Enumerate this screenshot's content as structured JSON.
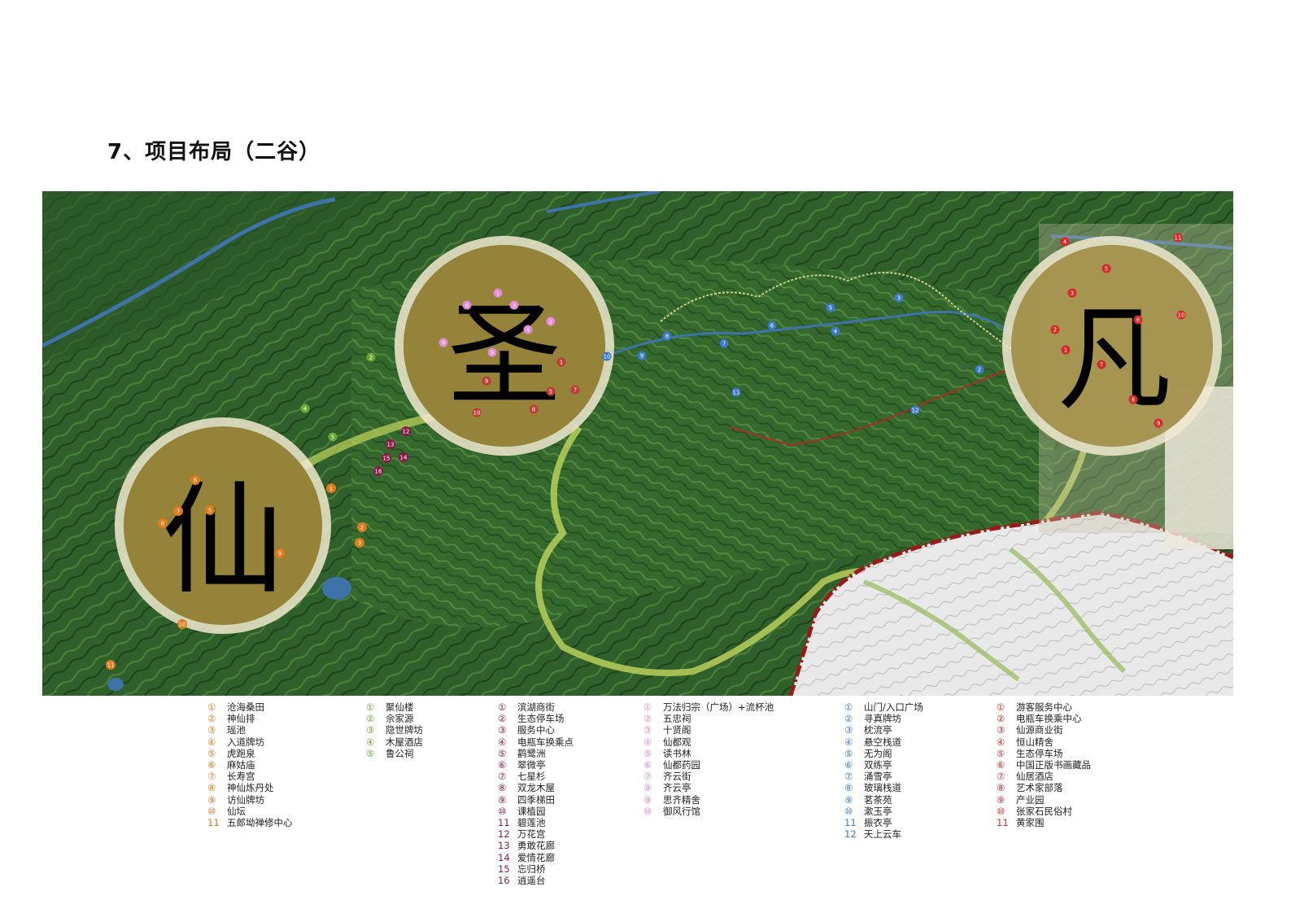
{
  "page": {
    "title": "7、项目布局（二谷）"
  },
  "zones": {
    "xian": "仙",
    "sheng": "圣",
    "fan": "凡"
  },
  "legend": {
    "col1": {
      "color": "#e07b1c",
      "items": [
        {
          "n": "①",
          "t": "沧海桑田"
        },
        {
          "n": "②",
          "t": "神仙排"
        },
        {
          "n": "③",
          "t": "瑶池"
        },
        {
          "n": "④",
          "t": "入道牌坊"
        },
        {
          "n": "⑤",
          "t": "虎跑泉"
        },
        {
          "n": "⑥",
          "t": "麻姑庙"
        },
        {
          "n": "⑦",
          "t": "长寿宫"
        },
        {
          "n": "⑧",
          "t": "神仙炼丹处"
        },
        {
          "n": "⑨",
          "t": "访仙牌坊"
        },
        {
          "n": "⑩",
          "t": "仙坛"
        },
        {
          "n": "11",
          "t": "五郎坳禅修中心"
        }
      ]
    },
    "col2": {
      "color": "#6aa632",
      "items": [
        {
          "n": "①",
          "t": "聚仙楼"
        },
        {
          "n": "②",
          "t": "佘家源"
        },
        {
          "n": "③",
          "t": "隐世牌坊"
        },
        {
          "n": "④",
          "t": "木屋酒店"
        },
        {
          "n": "⑤",
          "t": "鲁公祠"
        }
      ]
    },
    "col3": {
      "color": "#8a1a4a",
      "items": [
        {
          "n": "①",
          "t": "滨湖商街"
        },
        {
          "n": "②",
          "t": "生态停车场"
        },
        {
          "n": "③",
          "t": "服务中心"
        },
        {
          "n": "④",
          "t": "电瓶车换乘点"
        },
        {
          "n": "⑤",
          "t": "鹳鹭洲"
        },
        {
          "n": "⑥",
          "t": "翠微亭"
        },
        {
          "n": "⑦",
          "t": "七星杉"
        },
        {
          "n": "⑧",
          "t": "双龙木屋"
        },
        {
          "n": "⑨",
          "t": "四季梯田"
        },
        {
          "n": "⑩",
          "t": "课植园"
        },
        {
          "n": "11",
          "t": "碧莲池"
        },
        {
          "n": "12",
          "t": "万花宫"
        },
        {
          "n": "13",
          "t": "勇敢花廊"
        },
        {
          "n": "14",
          "t": "爱情花廊"
        },
        {
          "n": "15",
          "t": "忘归桥"
        },
        {
          "n": "16",
          "t": "逍遥台"
        }
      ]
    },
    "col4": {
      "color": "#e58ad6",
      "items": [
        {
          "n": "①",
          "t": "万法归宗（广场）+流杯池"
        },
        {
          "n": "②",
          "t": "五忠祠"
        },
        {
          "n": "③",
          "t": "十贤阁"
        },
        {
          "n": "④",
          "t": "仙都观"
        },
        {
          "n": "⑤",
          "t": "读书林"
        },
        {
          "n": "⑥",
          "t": "仙都药园"
        },
        {
          "n": "⑦",
          "t": "齐云街"
        },
        {
          "n": "⑧",
          "t": "齐云亭"
        },
        {
          "n": "⑨",
          "t": "思齐精舍"
        },
        {
          "n": "⑩",
          "t": "御风行馆"
        }
      ]
    },
    "col5": {
      "color": "#3a7ac8",
      "items": [
        {
          "n": "①",
          "t": "山门/入口广场"
        },
        {
          "n": "②",
          "t": "寻真牌坊"
        },
        {
          "n": "③",
          "t": "枕流亭"
        },
        {
          "n": "④",
          "t": "悬空栈道"
        },
        {
          "n": "⑤",
          "t": "无为阁"
        },
        {
          "n": "⑥",
          "t": "双练亭"
        },
        {
          "n": "⑦",
          "t": "涌雪亭"
        },
        {
          "n": "⑧",
          "t": "玻璃栈道"
        },
        {
          "n": "⑨",
          "t": "茗茶苑"
        },
        {
          "n": "⑩",
          "t": "漱玉亭"
        },
        {
          "n": "11",
          "t": "振衣亭"
        },
        {
          "n": "12",
          "t": "天上云车"
        }
      ]
    },
    "col6": {
      "color": "#d8282a",
      "items": [
        {
          "n": "①",
          "t": "游客服务中心"
        },
        {
          "n": "②",
          "t": "电瓶车换乘中心"
        },
        {
          "n": "③",
          "t": "仙源商业街"
        },
        {
          "n": "④",
          "t": "恒山精舍"
        },
        {
          "n": "⑤",
          "t": "生态停车场"
        },
        {
          "n": "⑥",
          "t": "中国正版书画藏品"
        },
        {
          "n": "⑦",
          "t": "仙居酒店"
        },
        {
          "n": "⑧",
          "t": "艺术家部落"
        },
        {
          "n": "⑨",
          "t": "产业园"
        },
        {
          "n": "⑩",
          "t": "张家石民俗村"
        },
        {
          "n": "11",
          "t": "黄家围"
        }
      ]
    }
  },
  "colors": {
    "forest": "#2e5e2a",
    "zone_circle": "#b59a3c",
    "river": "#3d73a8",
    "boundary": "#9b1a1a"
  }
}
